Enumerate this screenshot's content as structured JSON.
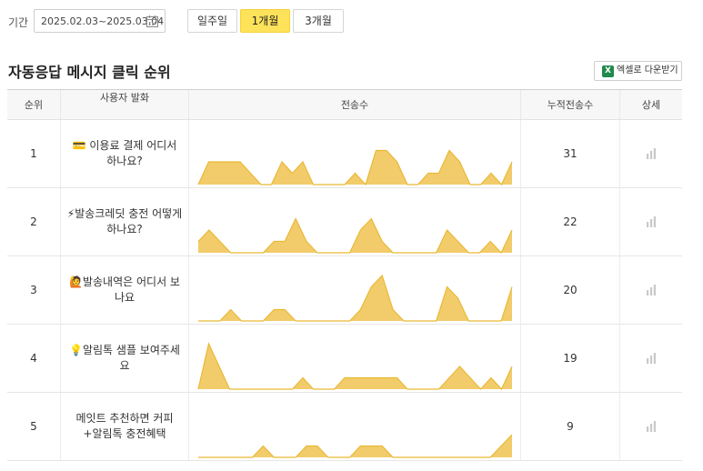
{
  "filter": {
    "label": "기간",
    "date_range": "2025.02.03~2025.03.04",
    "periods": [
      {
        "label": "일주일",
        "active": false
      },
      {
        "label": "1개월",
        "active": true
      },
      {
        "label": "3개월",
        "active": false
      }
    ]
  },
  "section": {
    "title": "자동응답 메시지 클릭 순위",
    "excel_button": "엑셀로 다운받기",
    "excel_icon": "excel-icon"
  },
  "table": {
    "headers": [
      "순위",
      "사용자 발화",
      "전송수",
      "누적전송수",
      "상세"
    ],
    "rows": [
      {
        "rank": "1",
        "utterance": "💳 이용료 결제 어디서 하나요?",
        "total": "31",
        "daily": [
          0,
          2,
          2,
          2,
          2,
          1,
          0,
          0,
          2,
          1,
          2,
          0,
          0,
          0,
          0,
          1,
          0,
          3,
          3,
          2,
          0,
          0,
          1,
          1,
          3,
          2,
          0,
          0,
          1,
          0,
          2
        ]
      },
      {
        "rank": "2",
        "utterance": "⚡발송크레딧 충전 어떻게 하나요?",
        "total": "22",
        "daily": [
          1,
          2,
          1,
          0,
          0,
          0,
          0,
          1,
          1,
          3,
          1,
          0,
          0,
          0,
          0,
          2,
          3,
          1,
          0,
          0,
          0,
          0,
          0,
          2,
          1,
          0,
          0,
          1,
          0,
          2
        ]
      },
      {
        "rank": "3",
        "utterance": "🙋발송내역은 어디서 보나요",
        "total": "20",
        "daily": [
          0,
          0,
          0,
          1,
          0,
          0,
          0,
          1,
          1,
          0,
          0,
          0,
          0,
          0,
          0,
          1,
          3,
          4,
          1,
          0,
          0,
          0,
          0,
          3,
          2,
          0,
          0,
          0,
          0,
          3
        ]
      },
      {
        "rank": "4",
        "utterance": "💡알림톡 샘플 보여주세요",
        "total": "19",
        "daily": [
          0,
          4,
          2,
          0,
          0,
          0,
          0,
          0,
          0,
          0,
          1,
          0,
          0,
          0,
          1,
          1,
          1,
          1,
          1,
          1,
          0,
          0,
          0,
          0,
          1,
          2,
          1,
          0,
          1,
          0,
          2
        ]
      },
      {
        "rank": "5",
        "utterance": "메잇트 추천하면 커피+알림톡 충전혜택",
        "total": "9",
        "daily": [
          0,
          0,
          0,
          0,
          0,
          0,
          1,
          0,
          0,
          0,
          1,
          1,
          0,
          0,
          0,
          1,
          1,
          1,
          0,
          0,
          0,
          0,
          0,
          0,
          0,
          0,
          0,
          0,
          1,
          2
        ]
      }
    ]
  },
  "colors": {
    "accent": "#fde25a",
    "area_fill": "#f2cc6b",
    "area_stroke": "#e9b935",
    "detail_icon": "#c9c9c9"
  }
}
